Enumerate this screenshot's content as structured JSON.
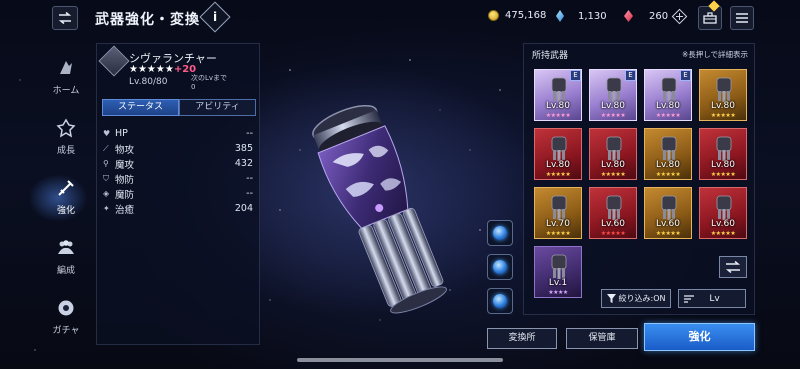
{
  "header": {
    "title": "武器強化・変換",
    "info_label": "i"
  },
  "currency": {
    "gil": "475,168",
    "crystals": "1,130",
    "gems": "260"
  },
  "nav": {
    "items": [
      {
        "label": "ホーム",
        "icon": "home-icon"
      },
      {
        "label": "成長",
        "icon": "growth-icon"
      },
      {
        "label": "強化",
        "icon": "enhance-icon"
      },
      {
        "label": "編成",
        "icon": "party-icon"
      },
      {
        "label": "ガチャ",
        "icon": "gacha-icon"
      }
    ],
    "active": "強化"
  },
  "weapon": {
    "name": "シヴァランチャー",
    "stars": "★★★★★",
    "plus": "+20",
    "level": "Lv.80/80",
    "next_label": "次のLvまで",
    "next_value": "0",
    "tabs": [
      "ステータス",
      "アビリティ"
    ],
    "stats": [
      {
        "name": "HP",
        "value": "--",
        "icon": "heart-icon"
      },
      {
        "name": "物攻",
        "value": "385",
        "icon": "sword-icon"
      },
      {
        "name": "魔攻",
        "value": "432",
        "icon": "staff-icon"
      },
      {
        "name": "物防",
        "value": "--",
        "icon": "shield-icon"
      },
      {
        "name": "魔防",
        "value": "--",
        "icon": "magic-shield-icon"
      },
      {
        "name": "治癒",
        "value": "204",
        "icon": "heal-icon"
      }
    ]
  },
  "inventory": {
    "title": "所持武器",
    "hint": "※長押しで詳細表示",
    "cards": [
      {
        "lv": "Lv.80",
        "stars": "★★★★★",
        "rarity": "purple",
        "star_color": "#ff9ad6",
        "equipped": "E"
      },
      {
        "lv": "Lv.80",
        "stars": "★★★★★",
        "rarity": "purple",
        "star_color": "#ff9ad6",
        "equipped": "E"
      },
      {
        "lv": "Lv.80",
        "stars": "★★★★★",
        "rarity": "purple",
        "star_color": "#ff9ad6",
        "equipped": "E"
      },
      {
        "lv": "Lv.80",
        "stars": "★★★★★",
        "rarity": "gold",
        "star_color": "#ffd24a",
        "equipped": ""
      },
      {
        "lv": "Lv.80",
        "stars": "★★★★★",
        "rarity": "red",
        "star_color": "#ffd24a",
        "equipped": ""
      },
      {
        "lv": "Lv.80",
        "stars": "★★★★★",
        "rarity": "red",
        "star_color": "#ffd24a",
        "equipped": ""
      },
      {
        "lv": "Lv.80",
        "stars": "★★★★★",
        "rarity": "gold",
        "star_color": "#ffd24a",
        "equipped": ""
      },
      {
        "lv": "Lv.80",
        "stars": "★★★★★",
        "rarity": "red",
        "star_color": "#ffd24a",
        "equipped": ""
      },
      {
        "lv": "Lv.70",
        "stars": "★★★★★",
        "rarity": "gold",
        "star_color": "#ffd24a",
        "equipped": ""
      },
      {
        "lv": "Lv.60",
        "stars": "★★★★★",
        "rarity": "red",
        "star_color": "#ff4a4a",
        "equipped": ""
      },
      {
        "lv": "Lv.60",
        "stars": "★★★★★",
        "rarity": "gold",
        "star_color": "#ffd24a",
        "equipped": ""
      },
      {
        "lv": "Lv.60",
        "stars": "★★★★★",
        "rarity": "red",
        "star_color": "#ffd24a",
        "equipped": ""
      },
      {
        "lv": "Lv.1",
        "stars": "★★★★",
        "rarity": "violet",
        "star_color": "#d6a8ff",
        "equipped": ""
      }
    ],
    "filter_label": "絞り込み:ON",
    "sort_label": "Lv"
  },
  "buttons": {
    "exchange": "変換所",
    "storage": "保管庫",
    "enhance": "強化"
  },
  "colors": {
    "accent": "#2e7fe0",
    "plus_text": "#ff5a8a"
  }
}
